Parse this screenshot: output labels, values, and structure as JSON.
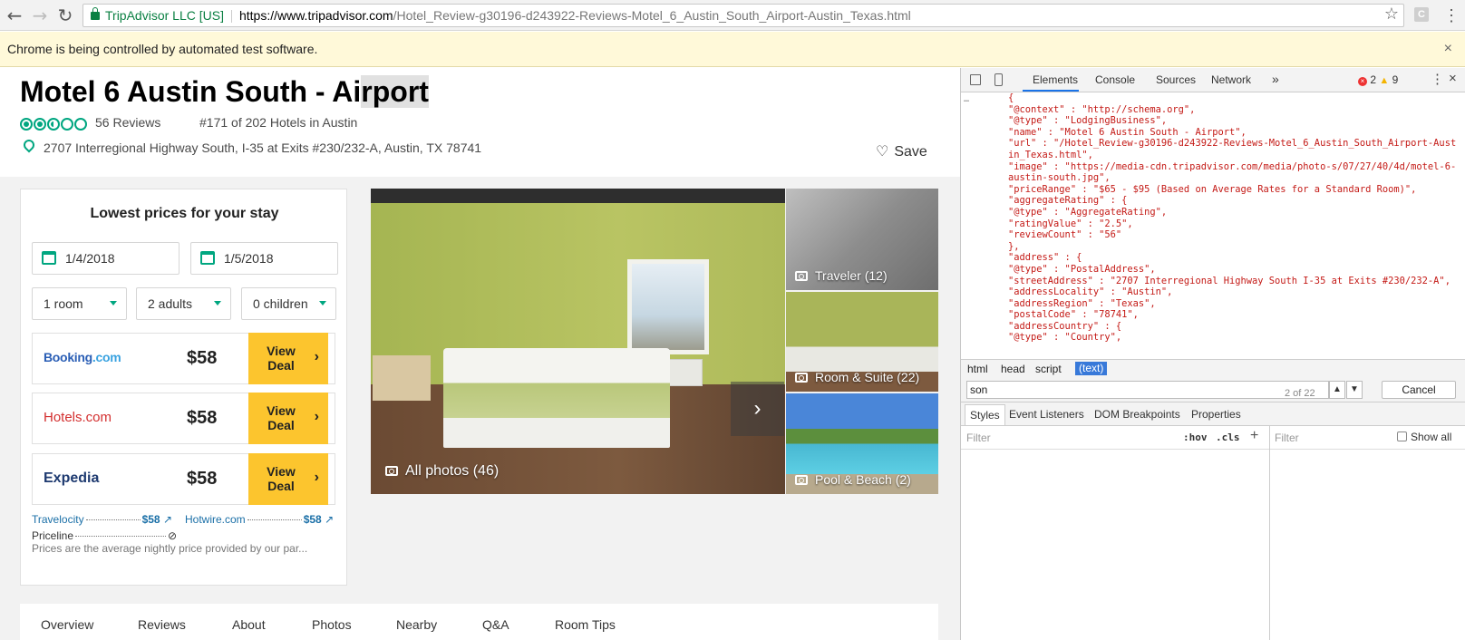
{
  "browser": {
    "secure_label": "TripAdvisor LLC [US]",
    "url_host": "https://www.tripadvisor.com",
    "url_path": "/Hotel_Review-g30196-d243922-Reviews-Motel_6_Austin_South_Airport-Austin_Texas.html",
    "back": "←",
    "forward": "→",
    "reload": "↻",
    "star": "☆",
    "extension": "C",
    "menu": "⋮",
    "infobar": "Chrome is being controlled by automated test software.",
    "infobar_close": "×"
  },
  "hotel": {
    "title_a": "Motel 6 Austin South - Ai",
    "title_b": "rport",
    "rating_value": 2.5,
    "reviews": "56 Reviews",
    "ranking": "#171 of 202 Hotels in Austin",
    "address": "2707 Interregional Highway South, I-35 at Exits #230/232-A, Austin, TX 78741",
    "save": "Save",
    "heart": "♡"
  },
  "booking": {
    "heading": "Lowest prices for your stay",
    "checkin": "1/4/2018",
    "checkout": "1/5/2018",
    "rooms": "1 room",
    "adults": "2 adults",
    "children": "0 children",
    "deals": [
      {
        "price": "$58",
        "button_line1": "View",
        "button_line2": "Deal"
      },
      {
        "price": "$58",
        "button_line1": "View",
        "button_line2": "Deal"
      },
      {
        "price": "$58",
        "button_line1": "View",
        "button_line2": "Deal"
      }
    ],
    "booking_logo_a": "Booking",
    "booking_logo_b": ".com",
    "hotels_logo": "Hotels.com",
    "expedia_logo": "Expedia",
    "other_sites": [
      {
        "name": "Travelocity",
        "price": "$58"
      },
      {
        "name": "Hotwire.com",
        "price": "$58"
      },
      {
        "name": "Priceline",
        "price": ""
      }
    ],
    "disclaimer": "Prices are the average nightly price provided by our par...",
    "chevron": "›",
    "external": "↗",
    "unavailable": "⊘"
  },
  "photos": {
    "all": "All photos (46)",
    "thumbs": [
      "Traveler (12)",
      "Room & Suite (22)",
      "Pool & Beach (2)"
    ],
    "next": "›"
  },
  "tabs": [
    "Overview",
    "Reviews",
    "About",
    "Photos",
    "Nearby",
    "Q&A",
    "Room Tips"
  ],
  "devtools": {
    "tabs": [
      "Elements",
      "Console",
      "Sources",
      "Network"
    ],
    "more": "»",
    "errors": "2",
    "warnings": "9",
    "close": "×",
    "kebab": "⋮",
    "gutter": "…",
    "code_lines": [
      "{",
      "\"@context\" : \"http://schema.org\",",
      "\"@type\" : \"LodgingBusiness\",",
      "\"name\" : \"Motel 6 Austin South - Airport\",",
      "\"url\" : \"/Hotel_Review-g30196-d243922-Reviews-Motel_6_Austin_South_Airport-Austin_Texas.html\",",
      "\"image\" : \"https://media-cdn.tripadvisor.com/media/photo-s/07/27/40/4d/motel-6-austin-south.jpg\",",
      "\"priceRange\" : \"$65 - $95 (Based on Average Rates for a Standard Room)\",",
      "\"aggregateRating\" : {",
      "\"@type\" : \"AggregateRating\",",
      "\"ratingValue\" : \"2.5\",",
      "\"reviewCount\" : \"56\"",
      "},",
      "\"address\" : {",
      "\"@type\" : \"PostalAddress\",",
      "\"streetAddress\" : \"2707 Interregional Highway South I-35 at Exits #230/232-A\",",
      "\"addressLocality\" : \"Austin\",",
      "\"addressRegion\" : \"Texas\",",
      "\"postalCode\" : \"78741\",",
      "\"addressCountry\" : {",
      "\"@type\" : \"Country\","
    ],
    "crumbs": [
      "html",
      "head",
      "script",
      "(text)"
    ],
    "search_value": "son",
    "search_count": "2 of 22",
    "search_up": "▲",
    "search_down": "▼",
    "cancel": "Cancel",
    "subtabs": [
      "Styles",
      "Event Listeners",
      "DOM Breakpoints",
      "Properties"
    ],
    "filter": "Filter",
    "hov": ":hov",
    "cls": ".cls",
    "plus": "+",
    "filter_right": "Filter",
    "show_all": "Show all"
  },
  "colors": {
    "tripadvisor_green": "#00a680",
    "deal_yellow": "#fcc52e",
    "devtools_string_red": "#c41a16",
    "infobar_yellow": "#fff9d9"
  }
}
